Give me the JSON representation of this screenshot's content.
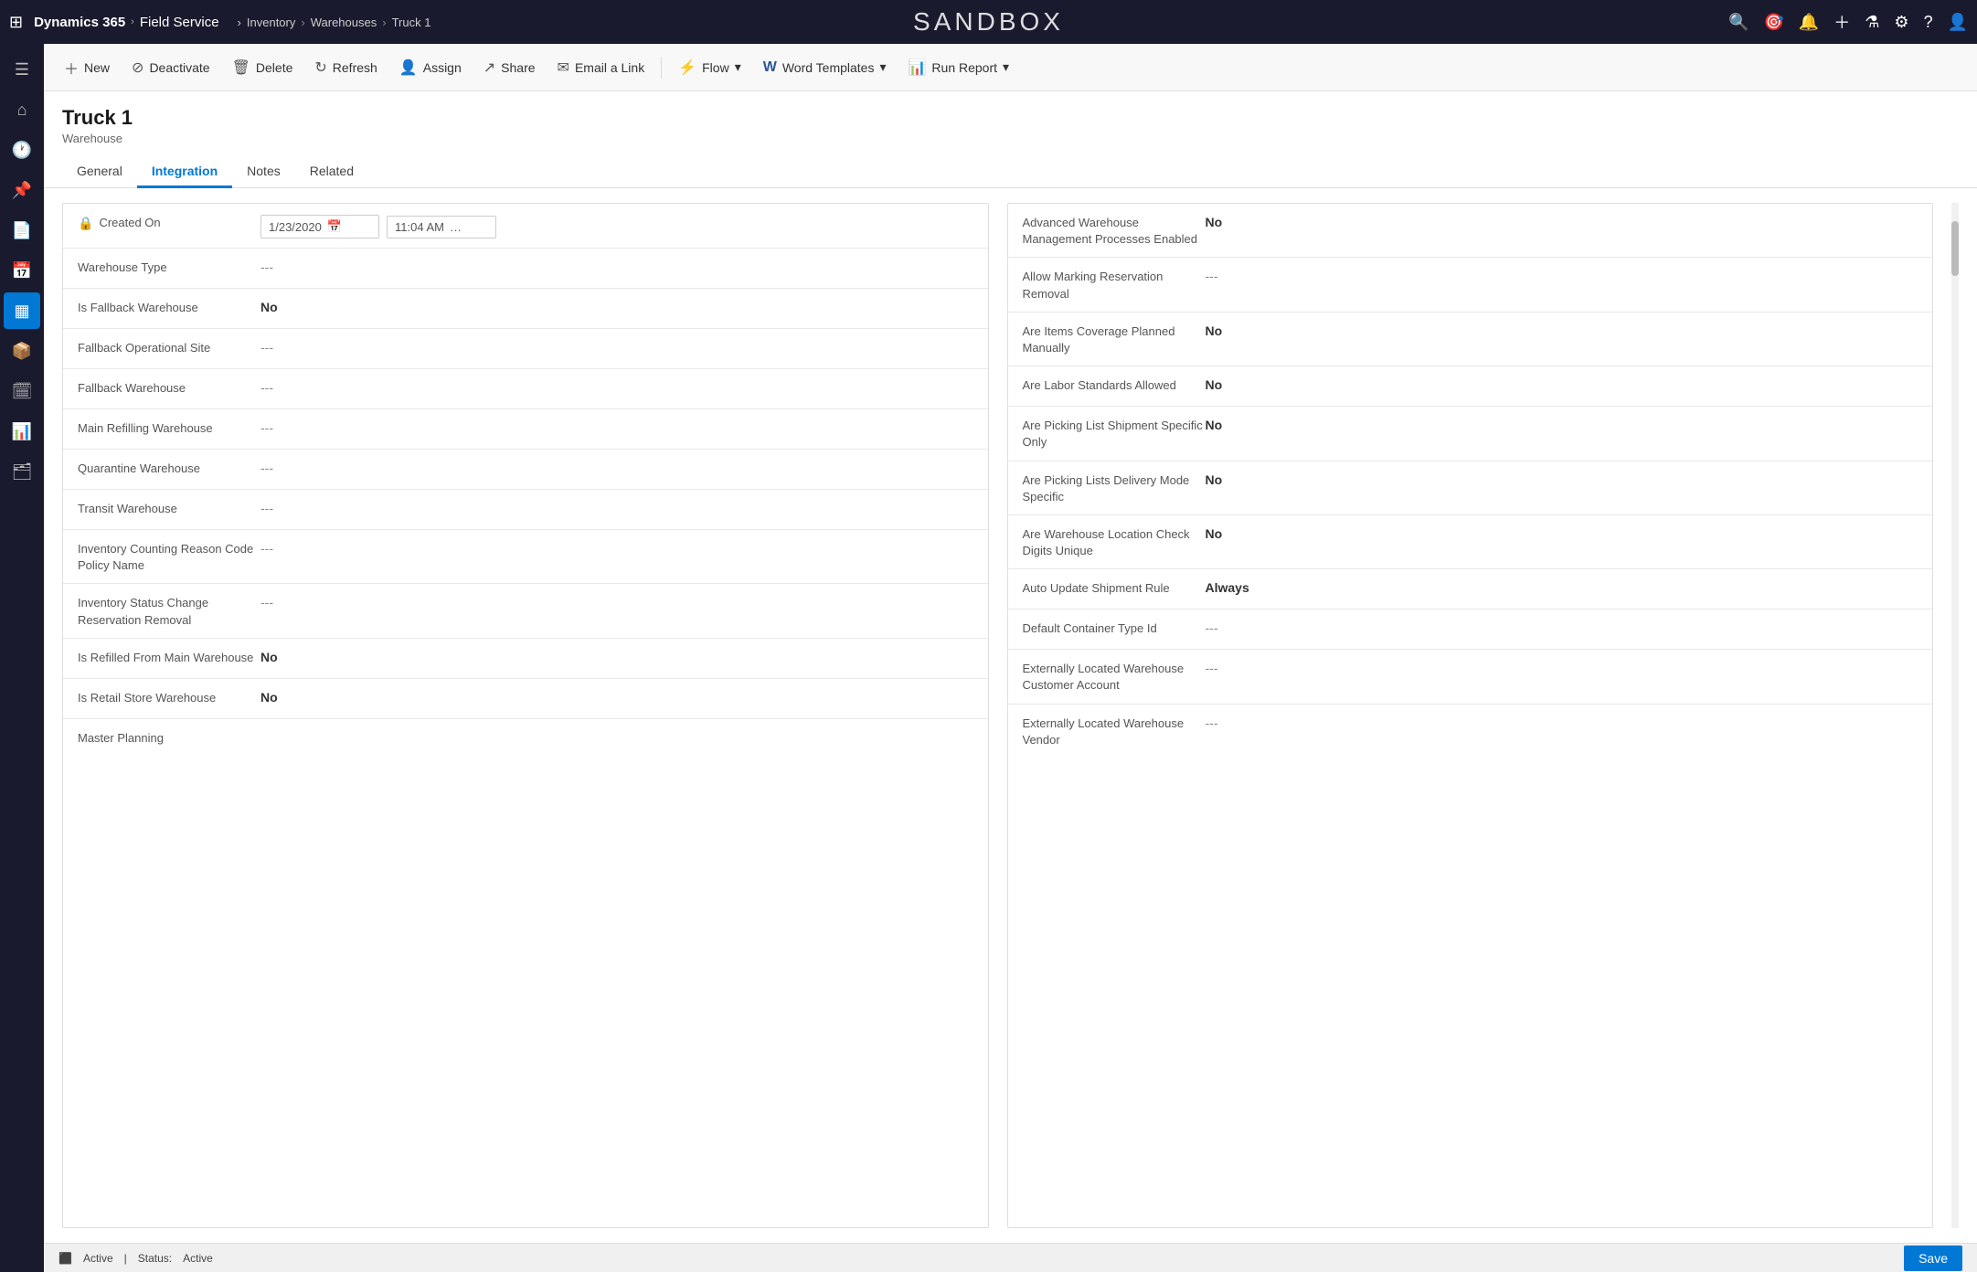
{
  "topNav": {
    "brand": "Dynamics 365",
    "chevron": "›",
    "app": "Field Service",
    "breadcrumbs": [
      "Inventory",
      "Warehouses",
      "Truck 1"
    ],
    "sandbox": "SANDBOX",
    "icons": [
      "search",
      "target",
      "bell",
      "plus",
      "filter",
      "settings",
      "help",
      "user"
    ]
  },
  "sidebar": {
    "items": [
      {
        "icon": "☰",
        "name": "menu"
      },
      {
        "icon": "⌂",
        "name": "home"
      },
      {
        "icon": "📋",
        "name": "recent"
      },
      {
        "icon": "📝",
        "name": "notes"
      },
      {
        "icon": "📄",
        "name": "docs"
      },
      {
        "icon": "📊",
        "name": "reports"
      },
      {
        "icon": "📦",
        "name": "inventory",
        "active": true
      },
      {
        "icon": "🔧",
        "name": "service"
      },
      {
        "icon": "📅",
        "name": "schedule"
      },
      {
        "icon": "📈",
        "name": "analytics"
      },
      {
        "icon": "🗂",
        "name": "records"
      }
    ]
  },
  "commandBar": {
    "buttons": [
      {
        "label": "New",
        "icon": "+",
        "name": "new-button"
      },
      {
        "label": "Deactivate",
        "icon": "⊘",
        "name": "deactivate-button"
      },
      {
        "label": "Delete",
        "icon": "🗑",
        "name": "delete-button"
      },
      {
        "label": "Refresh",
        "icon": "↻",
        "name": "refresh-button"
      },
      {
        "label": "Assign",
        "icon": "👤",
        "name": "assign-button"
      },
      {
        "label": "Share",
        "icon": "↗",
        "name": "share-button"
      },
      {
        "label": "Email a Link",
        "icon": "✉",
        "name": "email-link-button"
      },
      {
        "label": "Flow",
        "icon": "⚡",
        "name": "flow-button",
        "hasChevron": true
      },
      {
        "label": "Word Templates",
        "icon": "W",
        "name": "word-templates-button",
        "hasChevron": true
      },
      {
        "label": "Run Report",
        "icon": "📊",
        "name": "run-report-button",
        "hasChevron": true
      }
    ]
  },
  "pageHeader": {
    "title": "Truck 1",
    "subtitle": "Warehouse"
  },
  "tabs": [
    {
      "label": "General",
      "active": false
    },
    {
      "label": "Integration",
      "active": true
    },
    {
      "label": "Notes",
      "active": false
    },
    {
      "label": "Related",
      "active": false
    }
  ],
  "leftPanel": {
    "fields": [
      {
        "label": "Created On",
        "value": "",
        "type": "datetime",
        "date": "1/23/2020",
        "time": "11:04 AM",
        "locked": true
      },
      {
        "label": "Warehouse Type",
        "value": "---",
        "type": "muted"
      },
      {
        "label": "Is Fallback Warehouse",
        "value": "No",
        "type": "bold"
      },
      {
        "label": "Fallback Operational Site",
        "value": "---",
        "type": "muted"
      },
      {
        "label": "Fallback Warehouse",
        "value": "---",
        "type": "muted"
      },
      {
        "label": "Main Refilling Warehouse",
        "value": "---",
        "type": "muted"
      },
      {
        "label": "Quarantine Warehouse",
        "value": "---",
        "type": "muted"
      },
      {
        "label": "Transit Warehouse",
        "value": "---",
        "type": "muted"
      },
      {
        "label": "Inventory Counting Reason Code Policy Name",
        "value": "---",
        "type": "muted"
      },
      {
        "label": "Inventory Status Change Reservation Removal",
        "value": "---",
        "type": "muted"
      },
      {
        "label": "Is Refilled From Main Warehouse",
        "value": "No",
        "type": "bold"
      },
      {
        "label": "Is Retail Store Warehouse",
        "value": "No",
        "type": "bold"
      },
      {
        "label": "Master Planning",
        "value": "",
        "type": "muted"
      }
    ]
  },
  "rightPanel": {
    "fields": [
      {
        "label": "Advanced Warehouse Management Processes Enabled",
        "value": "No",
        "type": "bold"
      },
      {
        "label": "Allow Marking Reservation Removal",
        "value": "---",
        "type": "muted"
      },
      {
        "label": "Are Items Coverage Planned Manually",
        "value": "No",
        "type": "bold"
      },
      {
        "label": "Are Labor Standards Allowed",
        "value": "No",
        "type": "bold"
      },
      {
        "label": "Are Picking List Shipment Specific Only",
        "value": "No",
        "type": "bold"
      },
      {
        "label": "Are Picking Lists Delivery Mode Specific",
        "value": "No",
        "type": "bold"
      },
      {
        "label": "Are Warehouse Location Check Digits Unique",
        "value": "No",
        "type": "bold"
      },
      {
        "label": "Auto Update Shipment Rule",
        "value": "Always",
        "type": "bold"
      },
      {
        "label": "Default Container Type Id",
        "value": "---",
        "type": "muted"
      },
      {
        "label": "Externally Located Warehouse Customer Account",
        "value": "---",
        "type": "muted"
      },
      {
        "label": "Externally Located Warehouse Vendor",
        "value": "---",
        "type": "muted"
      }
    ]
  },
  "statusBar": {
    "status": "Active",
    "statusLabel": "Status:",
    "statusValue": "Active",
    "saveLabel": "Save"
  }
}
